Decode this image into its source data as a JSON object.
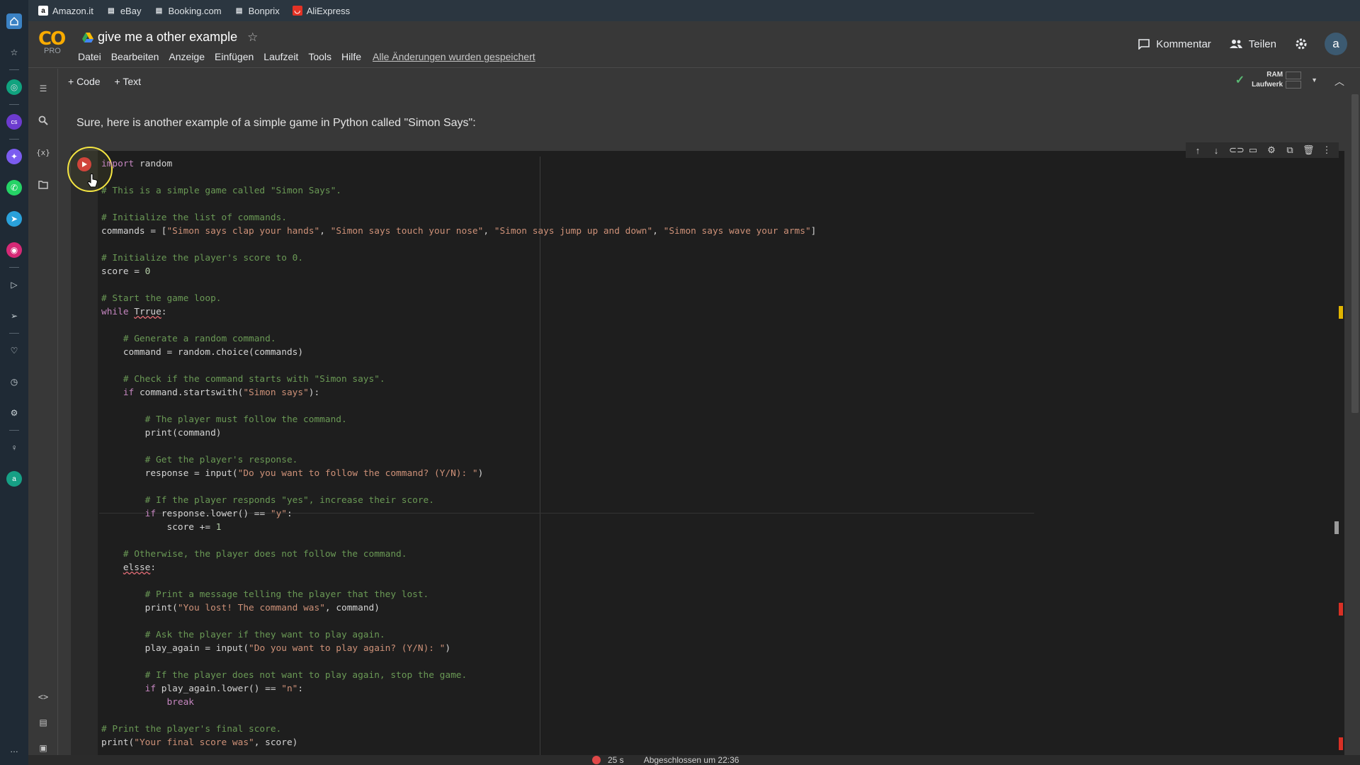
{
  "bookmarks": [
    {
      "label": "Amazon.it",
      "icon": "amazon-icon"
    },
    {
      "label": "eBay",
      "icon": "page-icon"
    },
    {
      "label": "Booking.com",
      "icon": "page-icon"
    },
    {
      "label": "Bonprix",
      "icon": "page-icon"
    },
    {
      "label": "AliExpress",
      "icon": "aliexpress-icon"
    }
  ],
  "header": {
    "logo_text": "CO",
    "logo_badge": "PRO",
    "title": "give me a other example",
    "menu": [
      "Datei",
      "Bearbeiten",
      "Anzeige",
      "Einfügen",
      "Laufzeit",
      "Tools",
      "Hilfe"
    ],
    "save_status": "Alle Änderungen wurden gespeichert",
    "comment_label": "Kommentar",
    "share_label": "Teilen",
    "avatar_letter": "a"
  },
  "toolbar": {
    "code_label": "+ Code",
    "text_label": "+ Text",
    "ram_label": "RAM",
    "disk_label": "Laufwerk"
  },
  "notebook": {
    "text_cell": "Sure, here is another example of a simple game in Python called \"Simon Says\":"
  },
  "code": {
    "lines": [
      "import random",
      "",
      "# This is a simple game called \"Simon Says\".",
      "",
      "# Initialize the list of commands.",
      "commands = [\"Simon says clap your hands\", \"Simon says touch your nose\", \"Simon says jump up and down\", \"Simon says wave your arms\"]",
      "",
      "# Initialize the player's score to 0.",
      "score = 0",
      "",
      "# Start the game loop.",
      "while Trrue:",
      "",
      "    # Generate a random command.",
      "    command = random.choice(commands)",
      "",
      "    # Check if the command starts with \"Simon says\".",
      "    if command.startswith(\"Simon says\"):",
      "",
      "        # The player must follow the command.",
      "        print(command)",
      "",
      "        # Get the player's response.",
      "        response = input(\"Do you want to follow the command? (Y/N): \")",
      "",
      "        # If the player responds \"yes\", increase their score.",
      "        if response.lower() == \"y\":",
      "            score += 1",
      "",
      "    # Otherwise, the player does not follow the command.",
      "    elsse:",
      "",
      "        # Print a message telling the player that they lost.",
      "        print(\"You lost! The command was\", command)",
      "",
      "        # Ask the player if they want to play again.",
      "        play_again = input(\"Do you want to play again? (Y/N): \")",
      "",
      "        # If the player does not want to play again, stop the game.",
      "        if play_again.lower() == \"n\":",
      "            break",
      "",
      "# Print the player's final score.",
      "print(\"Your final score was\", score)"
    ]
  },
  "status": {
    "duration": "25 s",
    "finished": "Abgeschlossen um 22:36"
  },
  "colors": {
    "accent": "#f9ab00",
    "run_error": "#cf3b3b",
    "marker_warning": "#e0b400",
    "marker_error": "#d93025"
  }
}
